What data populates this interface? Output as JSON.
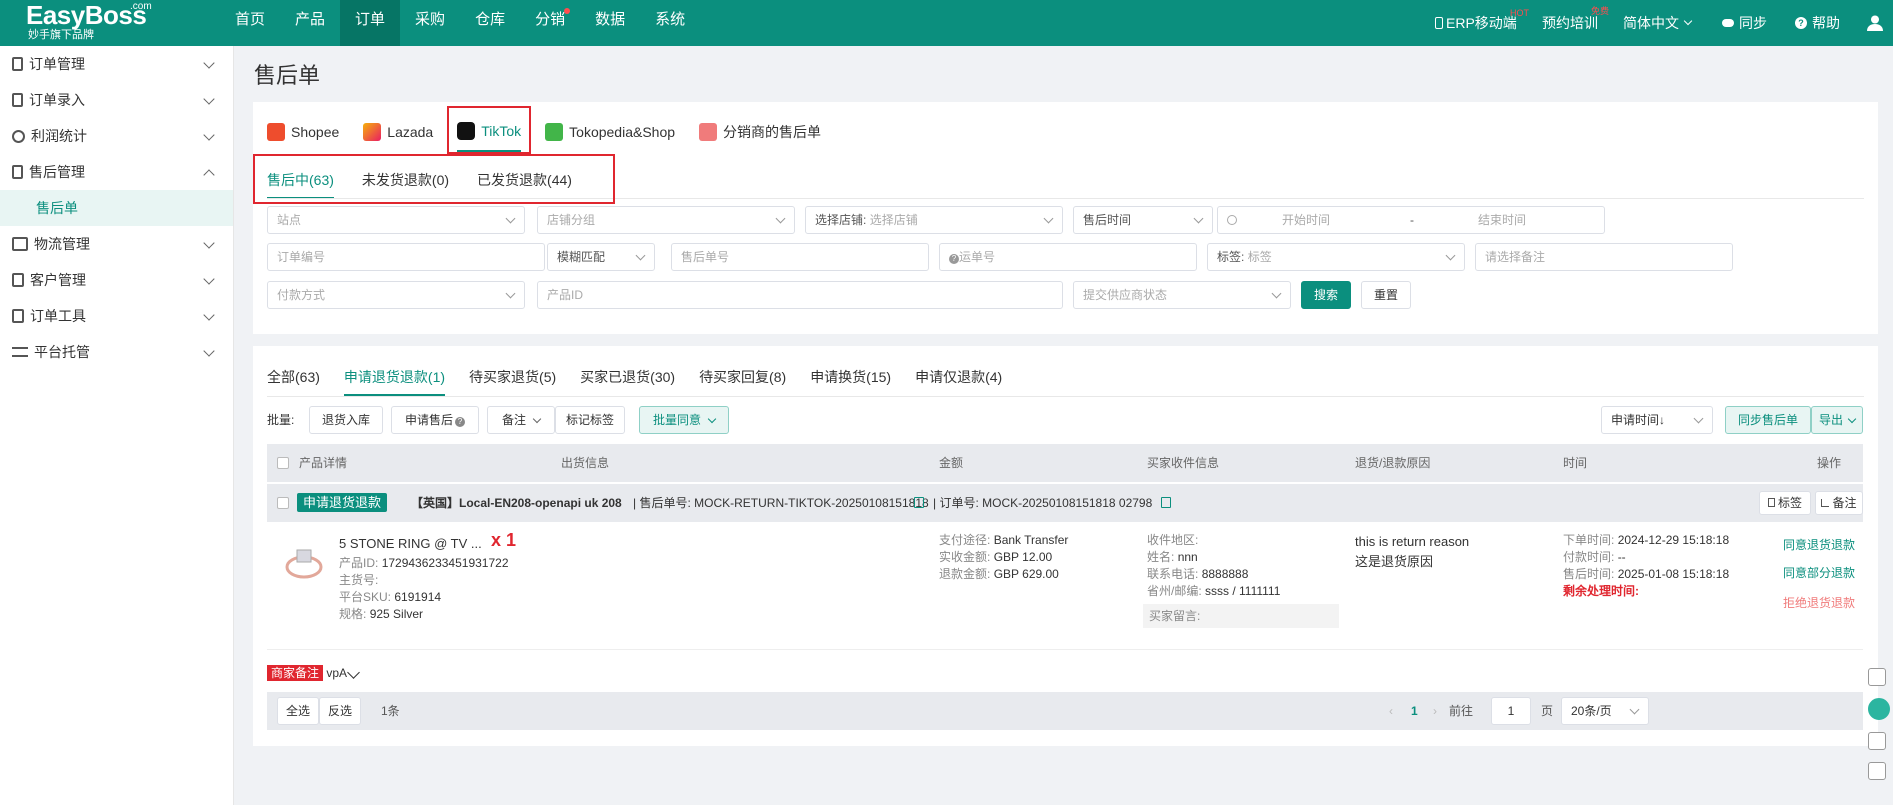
{
  "brand": {
    "name": "EasyBoss",
    "com": ".com",
    "slogan": "妙手旗下品牌"
  },
  "nav": [
    "首页",
    "产品",
    "订单",
    "采购",
    "仓库",
    "分销",
    "数据",
    "系统"
  ],
  "topright": {
    "erp": "ERP移动端",
    "hot": "HOT",
    "training": "预约培训",
    "free": "免费",
    "lang": "简体中文",
    "sync": "同步",
    "help": "帮助"
  },
  "sidebar": {
    "items": [
      "订单管理",
      "订单录入",
      "利润统计",
      "售后管理",
      "物流管理",
      "客户管理",
      "订单工具",
      "平台托管"
    ],
    "sub": "售后单"
  },
  "page": {
    "title": "售后单"
  },
  "platforms": [
    "Shopee",
    "Lazada",
    "TikTok",
    "Tokopedia&Shop",
    "分销商的售后单"
  ],
  "subtabs": [
    "售后中(63)",
    "未发货退款(0)",
    "已发货退款(44)"
  ],
  "filters": {
    "site": "站点",
    "shop_group": "店铺分组",
    "shop_label": "选择店铺:",
    "shop_ph": "选择店铺",
    "time_label": "售后时间",
    "start": "开始时间",
    "sep": "-",
    "end": "结束时间",
    "order_no": "订单编号",
    "match": "模糊匹配",
    "after_no": "售后单号",
    "tracking": "运单号",
    "tag_label": "标签:",
    "tag_ph": "标签",
    "remark": "请选择备注",
    "pay": "付款方式",
    "product_id": "产品ID",
    "supplier": "提交供应商状态",
    "search": "搜索",
    "reset": "重置"
  },
  "statustabs": [
    "全部(63)",
    "申请退货退款(1)",
    "待买家退货(5)",
    "买家已退货(30)",
    "待买家回复(8)",
    "申请换货(15)",
    "申请仅退款(4)"
  ],
  "batch": {
    "label": "批量:",
    "b1": "退货入库",
    "b2": "申请售后",
    "b3": "备注",
    "b4": "标记标签",
    "b5": "批量同意",
    "sort": "申请时间↓",
    "sync": "同步售后单",
    "export": "导出"
  },
  "columns": [
    "产品详情",
    "出货信息",
    "金额",
    "买家收件信息",
    "退货/退款原因",
    "时间",
    "操作"
  ],
  "order": {
    "status": "申请退货退款",
    "store": "【英国】Local-EN208-openapi uk 208",
    "after_label": "售后单号:",
    "after_no": "MOCK-RETURN-TIKTOK-20250108151818",
    "order_label": "订单号:",
    "order_no": "MOCK-20250108151818 02798",
    "tag_btn": "标签",
    "remark_btn": "备注",
    "product": {
      "name": "5 STONE RING @ TV ...",
      "qty": "x 1",
      "pid_k": "产品ID:",
      "pid": "1729436233451931722",
      "sku_k": "主货号:",
      "psku_k": "平台SKU:",
      "psku": "6191914",
      "spec_k": "规格:",
      "spec": "925 Silver"
    },
    "amount": {
      "pay_k": "支付途径:",
      "pay": "Bank Transfer",
      "paid_k": "实收金额:",
      "paid": "GBP 12.00",
      "refund_k": "退款金额:",
      "refund": "GBP 629.00"
    },
    "buyer": {
      "region_k": "收件地区:",
      "name_k": "姓名:",
      "name": "nnn",
      "phone_k": "联系电话:",
      "phone": "8888888",
      "zip_k": "省州/邮编:",
      "zip": "ssss / 1111111",
      "msg_k": "买家留言:"
    },
    "reason": {
      "en": "this is return reason",
      "zh": "这是退货原因"
    },
    "time": {
      "order_k": "下单时间:",
      "order": "2024-12-29 15:18:18",
      "pay_k": "付款时间:",
      "pay": "--",
      "after_k": "售后时间:",
      "after": "2025-01-08 15:18:18",
      "remain": "剩余处理时间:"
    },
    "ops": [
      "同意退货退款",
      "同意部分退款",
      "拒绝退货退款"
    ],
    "merchant_k": "商家备注",
    "merchant": "vpA"
  },
  "footer": {
    "all": "全选",
    "invert": "反选",
    "count": "1条",
    "page": "1",
    "goto": "前往",
    "page_input": "1",
    "page_unit": "页",
    "size": "20条/页"
  }
}
